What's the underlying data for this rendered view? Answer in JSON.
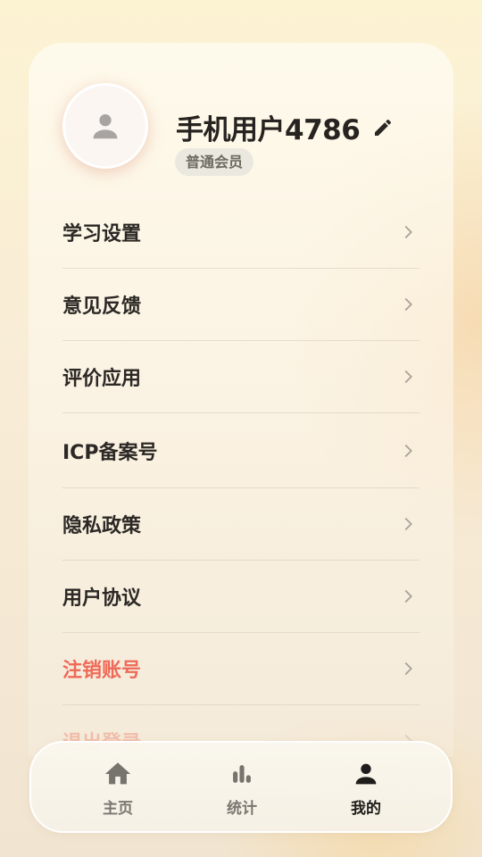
{
  "profile": {
    "username": "手机用户4786",
    "member_badge": "普通会员"
  },
  "menu": {
    "items": [
      {
        "label": "学习设置"
      },
      {
        "label": "意见反馈"
      },
      {
        "label": "评价应用"
      },
      {
        "label": "ICP备案号"
      },
      {
        "label": "隐私政策"
      },
      {
        "label": "用户协议"
      },
      {
        "label": "注销账号"
      },
      {
        "label": "退出登录"
      }
    ]
  },
  "tabbar": {
    "tabs": [
      {
        "label": "主页",
        "icon": "home-icon"
      },
      {
        "label": "统计",
        "icon": "bar-chart-icon"
      },
      {
        "label": "我的",
        "icon": "person-icon"
      }
    ],
    "active": "我的"
  },
  "colors": {
    "danger": "#ef6a58",
    "text": "#2b2825",
    "tab_inactive": "#7a7670",
    "tab_active": "#1f1d1b"
  }
}
